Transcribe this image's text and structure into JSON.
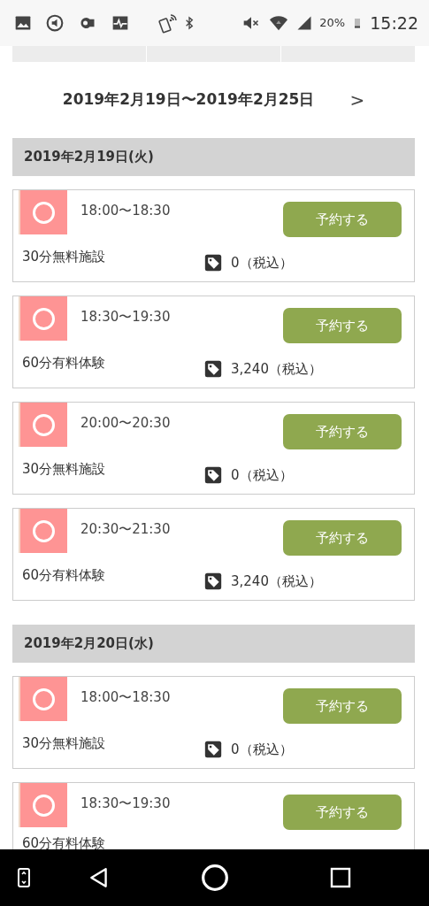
{
  "status_bar": {
    "battery": "20%",
    "time": "15:22"
  },
  "week_nav": {
    "range": "2019年2月19日〜2019年2月25日",
    "next": ">"
  },
  "days": [
    {
      "date": "2019年2月19日(火)",
      "slots": [
        {
          "available": true,
          "time": "18:00〜18:30",
          "button": "予約する",
          "name": "30分無料施設",
          "price": "0（税込）"
        },
        {
          "available": true,
          "time": "18:30〜19:30",
          "button": "予約する",
          "name": "60分有料体験",
          "price": "3,240（税込）"
        },
        {
          "available": true,
          "time": "20:00〜20:30",
          "button": "予約する",
          "name": "30分無料施設",
          "price": "0（税込）"
        },
        {
          "available": true,
          "time": "20:30〜21:30",
          "button": "予約する",
          "name": "60分有料体験",
          "price": "3,240（税込）"
        }
      ]
    },
    {
      "date": "2019年2月20日(水)",
      "slots": [
        {
          "available": true,
          "time": "18:00〜18:30",
          "button": "予約する",
          "name": "30分無料施設",
          "price": "0（税込）"
        },
        {
          "available": true,
          "time": "18:30〜19:30",
          "button": "予約する",
          "name": "60分有料体験"
        }
      ]
    }
  ]
}
